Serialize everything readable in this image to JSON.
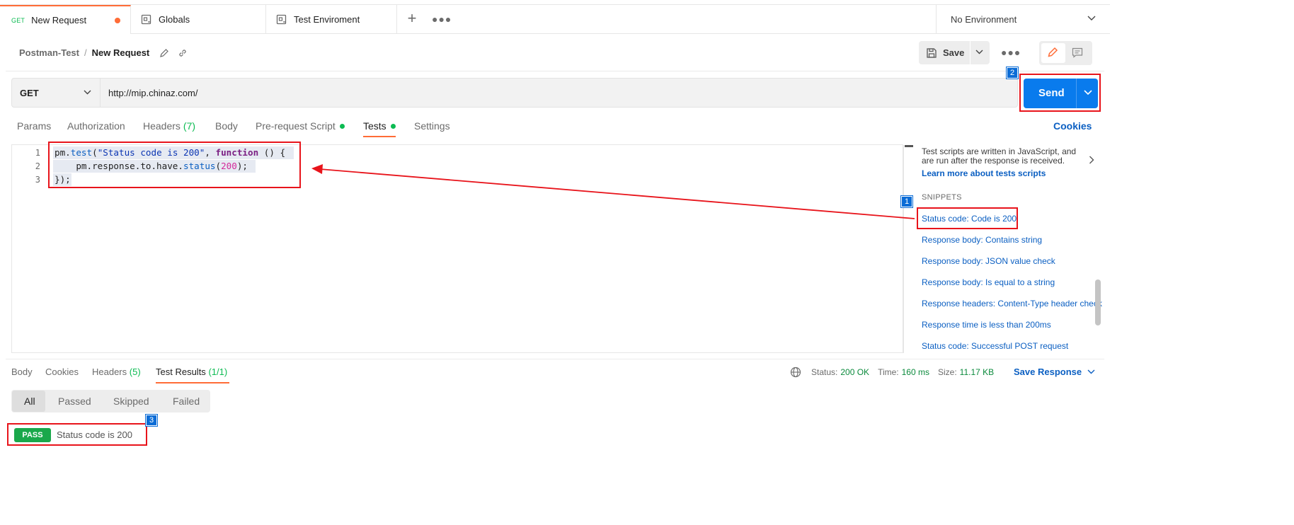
{
  "tabs": [
    {
      "method": "GET",
      "label": "New Request",
      "unsaved": true
    },
    {
      "label": "Globals"
    },
    {
      "label": "Test Enviroment"
    }
  ],
  "environment": "No Environment",
  "breadcrumb": {
    "collection": "Postman-Test",
    "separator": "/",
    "request": "New Request"
  },
  "toolbar": {
    "save_label": "Save"
  },
  "request": {
    "method": "GET",
    "url": "http://mip.chinaz.com/",
    "send_label": "Send"
  },
  "request_tabs": {
    "params": "Params",
    "authorization": "Authorization",
    "headers": "Headers",
    "headers_count": "(7)",
    "body": "Body",
    "prerequest": "Pre-request Script",
    "tests": "Tests",
    "settings": "Settings",
    "cookies": "Cookies"
  },
  "editor": {
    "line_numbers": [
      "1",
      "2",
      "3"
    ],
    "lines": [
      "pm.test(\"Status code is 200\", function () {",
      "    pm.response.to.have.status(200);",
      "});"
    ]
  },
  "snippets": {
    "description": "Test scripts are written in JavaScript, and are run after the response is received.",
    "learn_more": "Learn more about tests scripts",
    "title": "SNIPPETS",
    "items": [
      "Status code: Code is 200",
      "Response body: Contains string",
      "Response body: JSON value check",
      "Response body: Is equal to a string",
      "Response headers: Content-Type header check",
      "Response time is less than 200ms",
      "Status code: Successful POST request"
    ]
  },
  "annotations": {
    "step1": "1",
    "step2": "2",
    "step3": "3"
  },
  "response": {
    "tabs": {
      "body": "Body",
      "cookies": "Cookies",
      "headers": "Headers",
      "headers_count": "(5)",
      "test_results": "Test Results",
      "test_results_count": "(1/1)"
    },
    "status_label": "Status:",
    "status_value": "200 OK",
    "time_label": "Time:",
    "time_value": "160 ms",
    "size_label": "Size:",
    "size_value": "11.17 KB",
    "save_response": "Save Response",
    "filters": [
      "All",
      "Passed",
      "Skipped",
      "Failed"
    ],
    "results": [
      {
        "badge": "PASS",
        "name": "Status code is 200"
      }
    ]
  },
  "colors": {
    "accent": "#ff6c37",
    "send": "#097bed",
    "pass": "#1aa84b",
    "highlight": "#e8141b",
    "link": "#0b5fc2"
  }
}
